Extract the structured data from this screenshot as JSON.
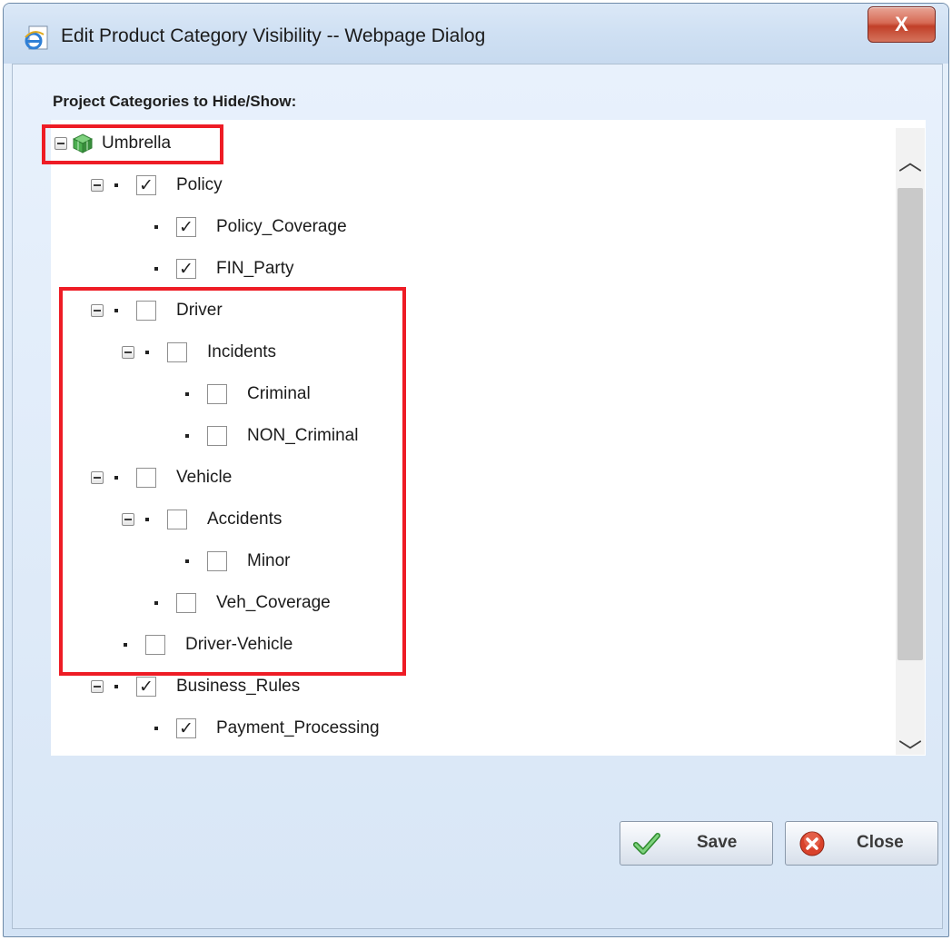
{
  "window": {
    "title": "Edit Product Category Visibility -- Webpage Dialog",
    "close_glyph": "X"
  },
  "section": {
    "label": "Project Categories to Hide/Show:"
  },
  "tree": {
    "root": "Umbrella",
    "nodes": [
      {
        "label": "Policy",
        "checked": "✓"
      },
      {
        "label": "Policy_Coverage",
        "checked": "✓"
      },
      {
        "label": "FIN_Party",
        "checked": "✓"
      },
      {
        "label": "Driver",
        "checked": ""
      },
      {
        "label": "Incidents",
        "checked": ""
      },
      {
        "label": "Criminal",
        "checked": ""
      },
      {
        "label": "NON_Criminal",
        "checked": ""
      },
      {
        "label": "Vehicle",
        "checked": ""
      },
      {
        "label": "Accidents",
        "checked": ""
      },
      {
        "label": "Minor",
        "checked": ""
      },
      {
        "label": "Veh_Coverage",
        "checked": ""
      },
      {
        "label": "Driver-Vehicle",
        "checked": ""
      },
      {
        "label": "Business_Rules",
        "checked": "✓"
      },
      {
        "label": "Payment_Processing",
        "checked": "✓"
      }
    ]
  },
  "scrollbar": {
    "up_glyph": "︿",
    "down_glyph": "﹀"
  },
  "buttons": {
    "save": "Save",
    "close": "Close"
  },
  "colors": {
    "highlight": "#ee1c25",
    "save_check": "#3aa23a",
    "close_icon": "#d9422b"
  }
}
